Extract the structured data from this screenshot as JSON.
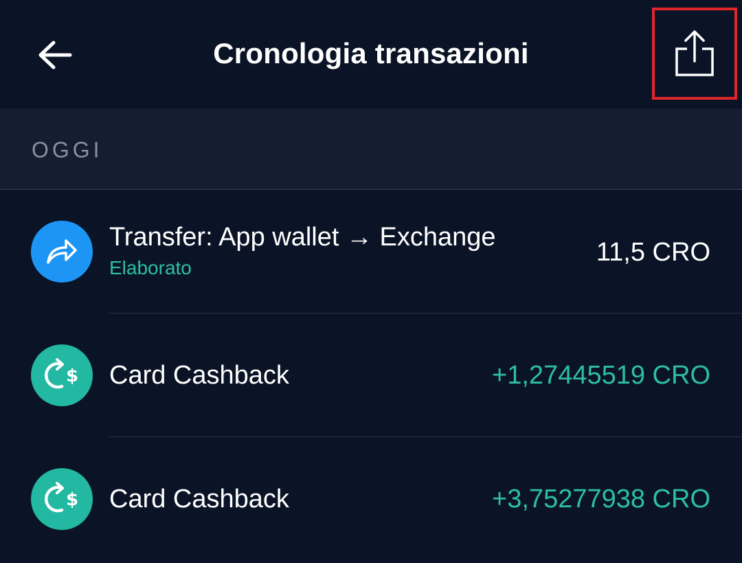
{
  "header": {
    "title": "Cronologia transazioni",
    "back_icon": "arrow-left-icon",
    "export_icon": "share-export-icon",
    "highlight_color": "#e0262b"
  },
  "section": {
    "label": "OGGI"
  },
  "transactions": [
    {
      "title": "Transfer: App wallet → Exchange",
      "status": "Elaborato",
      "amount": "11,5 CRO",
      "icon": "transfer-arrow-icon",
      "icon_color": "#1d95f5",
      "amount_color": "#ffffff"
    },
    {
      "title": "Card Cashback",
      "amount": "+1,27445519 CRO",
      "icon": "cashback-icon",
      "icon_color": "#22b8a2",
      "amount_color": "#2dbfa3"
    },
    {
      "title": "Card Cashback",
      "amount": "+3,75277938 CRO",
      "icon": "cashback-icon",
      "icon_color": "#22b8a2",
      "amount_color": "#2dbfa3"
    }
  ]
}
